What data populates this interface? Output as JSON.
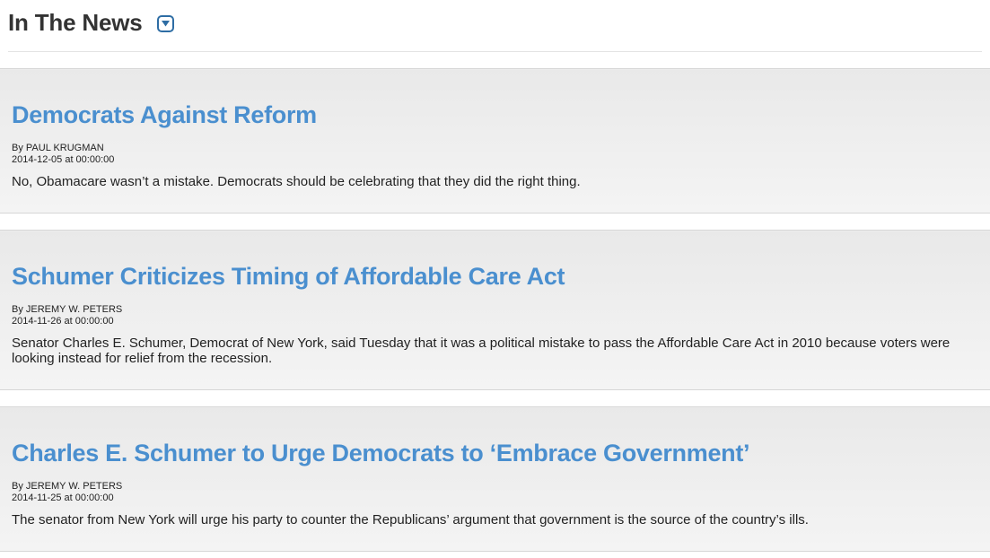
{
  "section": {
    "title": "In The News",
    "toggle_icon": "chevron-down-icon",
    "accent_color": "#2e6da4"
  },
  "articles": [
    {
      "title": "Democrats Against Reform",
      "author": "By PAUL KRUGMAN",
      "date": "2014-12-05 at 00:00:00",
      "summary": "No, Obamacare wasn’t a mistake. Democrats should be celebrating that they did the right thing."
    },
    {
      "title": "Schumer Criticizes Timing of Affordable Care Act",
      "author": "By JEREMY W. PETERS",
      "date": "2014-11-26 at 00:00:00",
      "summary": "Senator Charles E. Schumer, Democrat of New York, said Tuesday that it was a political mistake to pass the Affordable Care Act in 2010 because voters were looking instead for relief from the recession."
    },
    {
      "title": "Charles E. Schumer to Urge Democrats to ‘Embrace Government’",
      "author": "By JEREMY W. PETERS",
      "date": "2014-11-25 at 00:00:00",
      "summary": "The senator from New York will urge his party to counter the Republicans’ argument that government is the source of the country’s ills."
    }
  ],
  "colors": {
    "link": "#4a8fcf",
    "card_background": "#eeeeee",
    "text": "#222222"
  }
}
